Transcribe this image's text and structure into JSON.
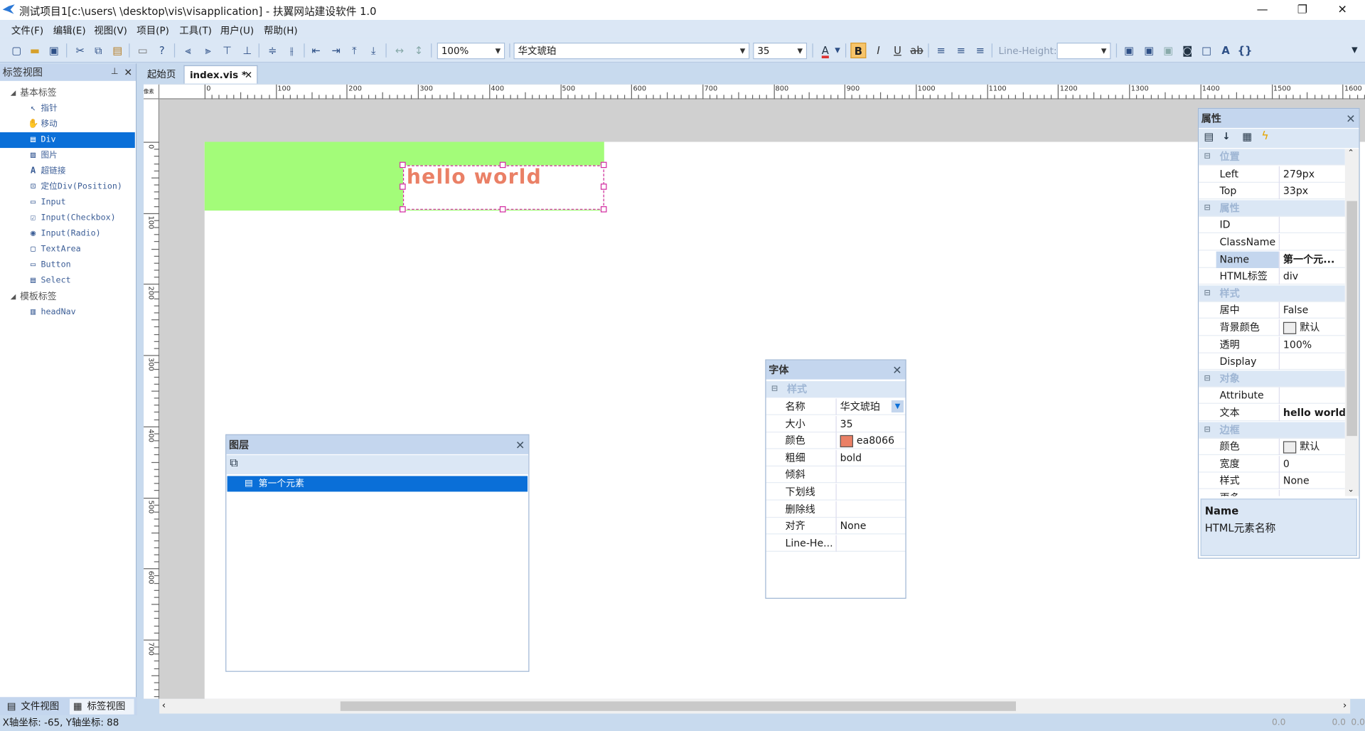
{
  "window": {
    "title": "测试项目1[c:\\users\\      \\desktop\\vis\\visapplication] - 扶翼网站建设软件 1.0",
    "minimize": "—",
    "restore": "❐",
    "close": "✕"
  },
  "menu": [
    "文件(F)",
    "编辑(E)",
    "视图(V)",
    "项目(P)",
    "工具(T)",
    "用户(U)",
    "帮助(H)"
  ],
  "toolbar": {
    "zoom": "100%",
    "font": "华文琥珀",
    "size": "35",
    "line_height_label": "Line-Height:",
    "line_height_value": "",
    "bold": "B",
    "italic": "I",
    "underline": "U",
    "strike": "ab",
    "font_color_glyph": "A",
    "text_glyph": "A",
    "code_glyph": "{}"
  },
  "left_panel": {
    "title": "标签视图",
    "groups": [
      {
        "label": "基本标签",
        "items": [
          "指针",
          "移动",
          "Div",
          "图片",
          "超链接",
          "定位Div(Position)",
          "Input",
          "Input(Checkbox)",
          "Input(Radio)",
          "TextArea",
          "Button",
          "Select"
        ]
      },
      {
        "label": "模板标签",
        "items": [
          "headNav"
        ]
      }
    ],
    "bottom_tabs": [
      "文件视图",
      "标签视图"
    ]
  },
  "doc_tabs": [
    {
      "label": "起始页"
    },
    {
      "label": "index.vis *"
    }
  ],
  "ruler": {
    "unit": "像素",
    "h_labels": [
      "0",
      "100",
      "200",
      "300",
      "400",
      "500",
      "600",
      "700",
      "800",
      "900",
      "1000",
      "1100",
      "1200",
      "1300",
      "1400",
      "1500",
      "1600"
    ],
    "v_labels": [
      "0",
      "100",
      "200",
      "300",
      "400",
      "500",
      "600",
      "700"
    ]
  },
  "canvas": {
    "element_text": "hello world",
    "element_color": "#ea8066",
    "bg_color": "#a3fc79"
  },
  "layers": {
    "title": "图层",
    "items": [
      "第一个元素"
    ]
  },
  "font_panel": {
    "title": "字体",
    "category": "样式",
    "rows": [
      {
        "label": "名称",
        "value": "华文琥珀"
      },
      {
        "label": "大小",
        "value": "35"
      },
      {
        "label": "颜色",
        "value": "ea8066",
        "swatch": "#ea8066"
      },
      {
        "label": "粗细",
        "value": "bold"
      },
      {
        "label": "倾斜",
        "value": ""
      },
      {
        "label": "下划线",
        "value": ""
      },
      {
        "label": "删除线",
        "value": ""
      },
      {
        "label": "对齐",
        "value": "None"
      },
      {
        "label": "Line-He...",
        "value": ""
      }
    ]
  },
  "props": {
    "title": "属性",
    "rows": [
      {
        "cat": "位置"
      },
      {
        "label": "Left",
        "value": "279px"
      },
      {
        "label": "Top",
        "value": "33px"
      },
      {
        "cat": "属性"
      },
      {
        "label": "ID",
        "value": ""
      },
      {
        "label": "ClassName",
        "value": ""
      },
      {
        "label": "Name",
        "value": "第一个元...",
        "selected": true,
        "bold": true
      },
      {
        "label": "HTML标签",
        "value": "div"
      },
      {
        "cat": "样式"
      },
      {
        "label": "居中",
        "value": "False"
      },
      {
        "label": "背景颜色",
        "value": "默认",
        "swatch": "#eeeeee"
      },
      {
        "label": "透明",
        "value": "100%"
      },
      {
        "label": "Display",
        "value": ""
      },
      {
        "cat": "对象"
      },
      {
        "label": "Attribute",
        "value": ""
      },
      {
        "label": "文本",
        "value": "hello world",
        "bold": true
      },
      {
        "cat": "边框"
      },
      {
        "label": "颜色",
        "value": "默认",
        "swatch": "#eeeeee"
      },
      {
        "label": "宽度",
        "value": "0"
      },
      {
        "label": "样式",
        "value": "None"
      },
      {
        "label": "更多",
        "value": ""
      }
    ],
    "desc_title": "Name",
    "desc_text": "HTML元素名称"
  },
  "status": {
    "coords": "X轴坐标: -65, Y轴坐标: 88",
    "right1": "0.0",
    "right2": "0.0",
    "right3": "0.0"
  }
}
